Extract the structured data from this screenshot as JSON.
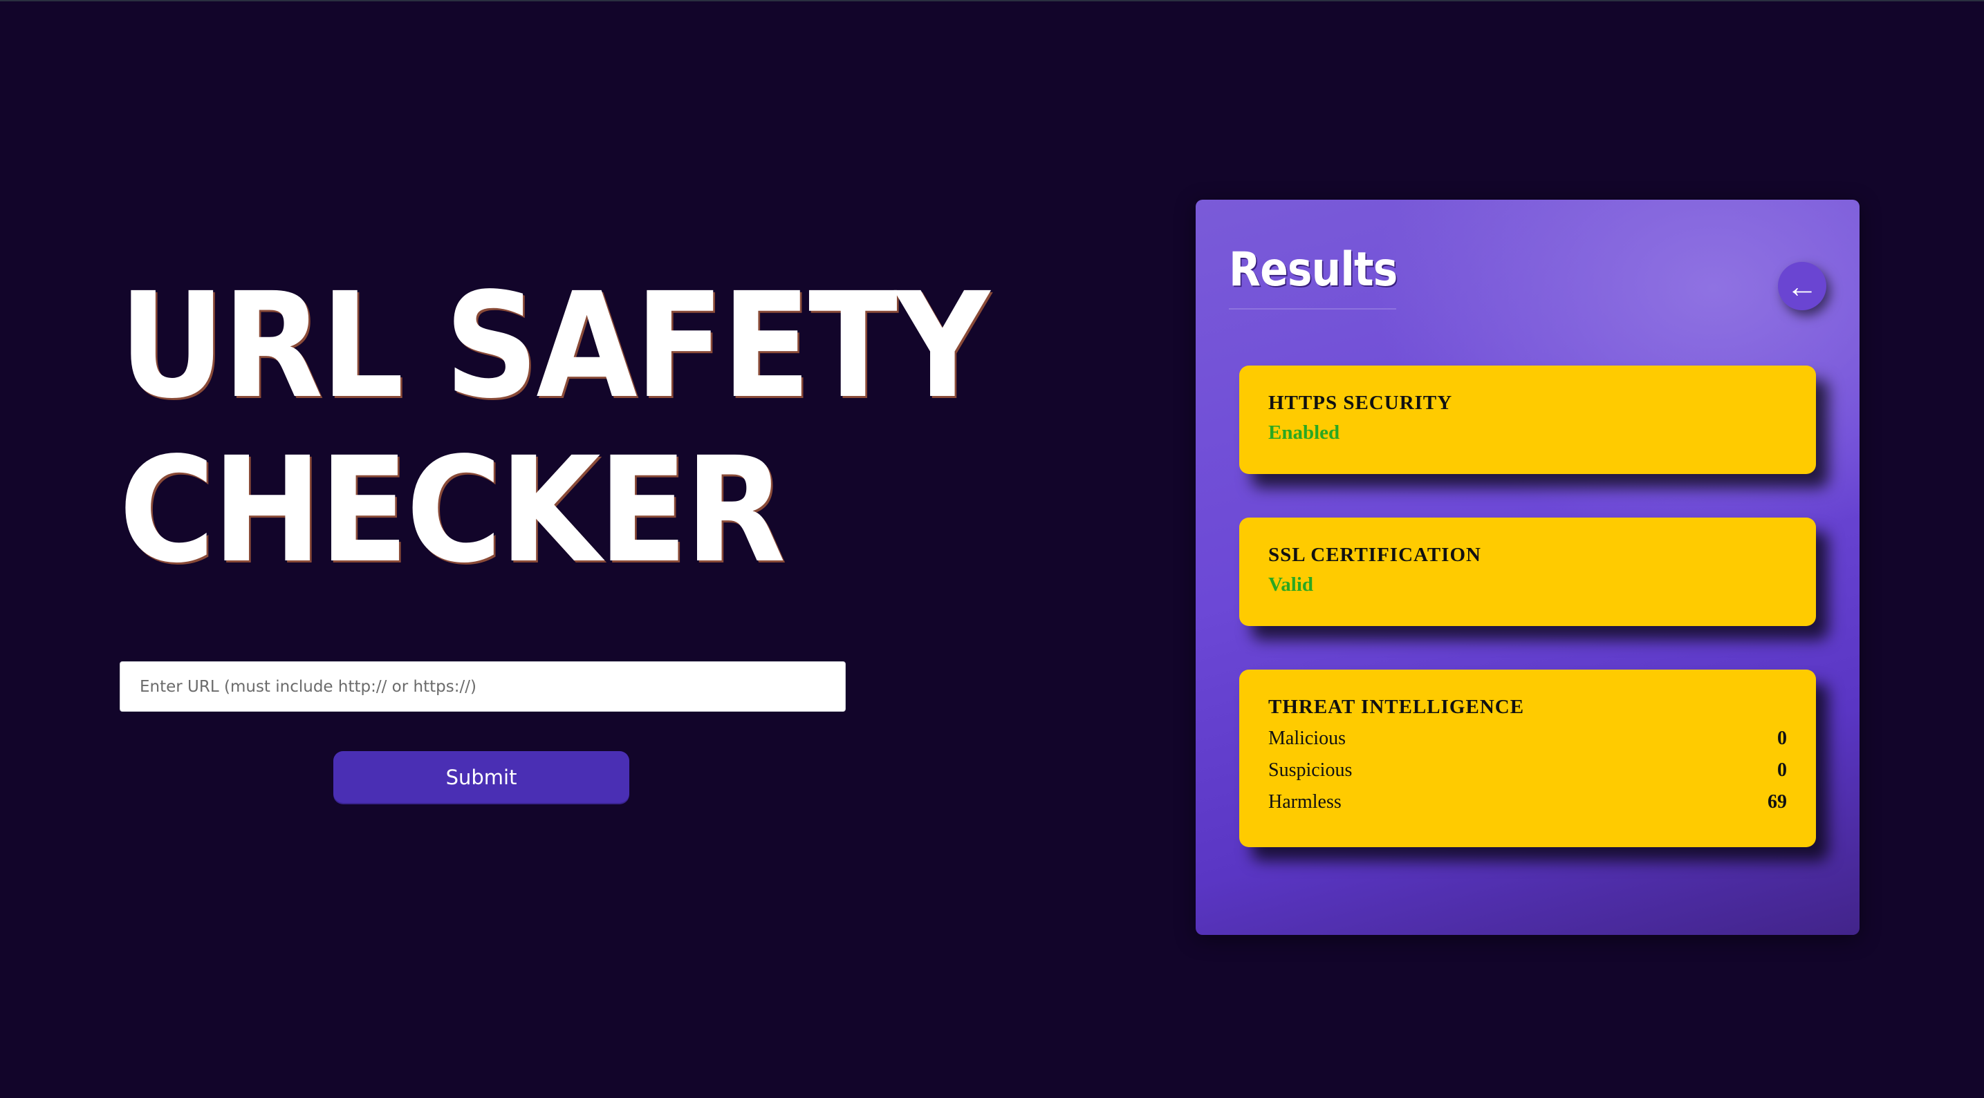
{
  "hero": {
    "title_line1": "URL SAFETY",
    "title_line2": "CHECKER"
  },
  "form": {
    "url_placeholder": "Enter URL (must include http:// or https://)",
    "url_value": "",
    "submit_label": "Submit"
  },
  "results": {
    "title": "Results",
    "back_icon": "←",
    "https": {
      "heading": "HTTPS SECURITY",
      "status": "Enabled"
    },
    "ssl": {
      "heading": "SSL CERTIFICATION",
      "status": "Valid"
    },
    "threat": {
      "heading": "THREAT INTELLIGENCE",
      "stats": [
        {
          "label": "Malicious",
          "value": "0"
        },
        {
          "label": "Suspicious",
          "value": "0"
        },
        {
          "label": "Harmless",
          "value": "69"
        }
      ]
    }
  },
  "colors": {
    "background": "#12052a",
    "panel": "#6c48d6",
    "card": "#ffcb00",
    "status_good": "#2aa821",
    "button": "#4a2fb4"
  }
}
